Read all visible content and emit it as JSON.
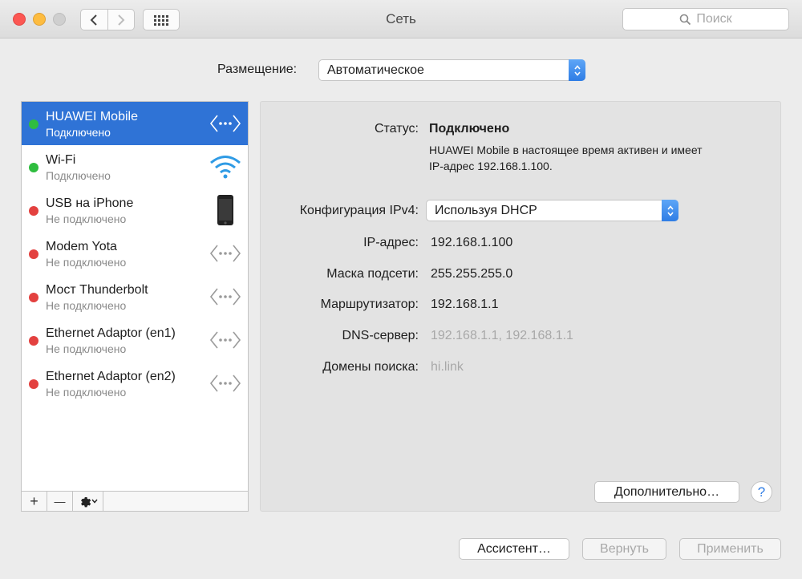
{
  "window": {
    "title": "Сеть"
  },
  "search": {
    "placeholder": "Поиск"
  },
  "location": {
    "label": "Размещение:",
    "value": "Автоматическое"
  },
  "services": [
    {
      "name": "HUAWEI Mobile",
      "status": "Подключено",
      "connected": true,
      "selected": true,
      "icon": "network-arrows-icon"
    },
    {
      "name": "Wi-Fi",
      "status": "Подключено",
      "connected": true,
      "selected": false,
      "icon": "wifi-icon"
    },
    {
      "name": "USB на iPhone",
      "status": "Не подключено",
      "connected": false,
      "selected": false,
      "icon": "iphone-icon"
    },
    {
      "name": "Modem Yota",
      "status": "Не подключено",
      "connected": false,
      "selected": false,
      "icon": "network-arrows-icon"
    },
    {
      "name": "Мост Thunderbolt",
      "status": "Не подключено",
      "connected": false,
      "selected": false,
      "icon": "network-arrows-icon"
    },
    {
      "name": "Ethernet Adaptor (en1)",
      "status": "Не подключено",
      "connected": false,
      "selected": false,
      "icon": "network-arrows-icon"
    },
    {
      "name": "Ethernet Adaptor (en2)",
      "status": "Не подключено",
      "connected": false,
      "selected": false,
      "icon": "network-arrows-icon"
    }
  ],
  "detail": {
    "status_label": "Статус:",
    "status_value": "Подключено",
    "status_desc_line1": "HUAWEI Mobile в настоящее время активен и имеет",
    "status_desc_line2": "IP-адрес 192.168.1.100.",
    "ipv4_label": "Конфигурация IPv4:",
    "ipv4_value": "Используя DHCP",
    "ip_label": "IP-адрес:",
    "ip_value": "192.168.1.100",
    "mask_label": "Маска подсети:",
    "mask_value": "255.255.255.0",
    "router_label": "Маршрутизатор:",
    "router_value": "192.168.1.1",
    "dns_label": "DNS-сервер:",
    "dns_value": "192.168.1.1, 192.168.1.1",
    "domains_label": "Домены поиска:",
    "domains_value": "hi.link",
    "advanced_label": "Дополнительно…",
    "help_label": "?"
  },
  "sidebar_bar": {
    "add": "+",
    "remove": "—"
  },
  "footer": {
    "assistant_label": "Ассистент…",
    "revert_label": "Вернуть",
    "apply_label": "Применить"
  },
  "colors": {
    "selection": "#2f73d6",
    "connected": "#2fbd3f",
    "disconnected": "#e3413f",
    "accent": "#2f7de5"
  }
}
